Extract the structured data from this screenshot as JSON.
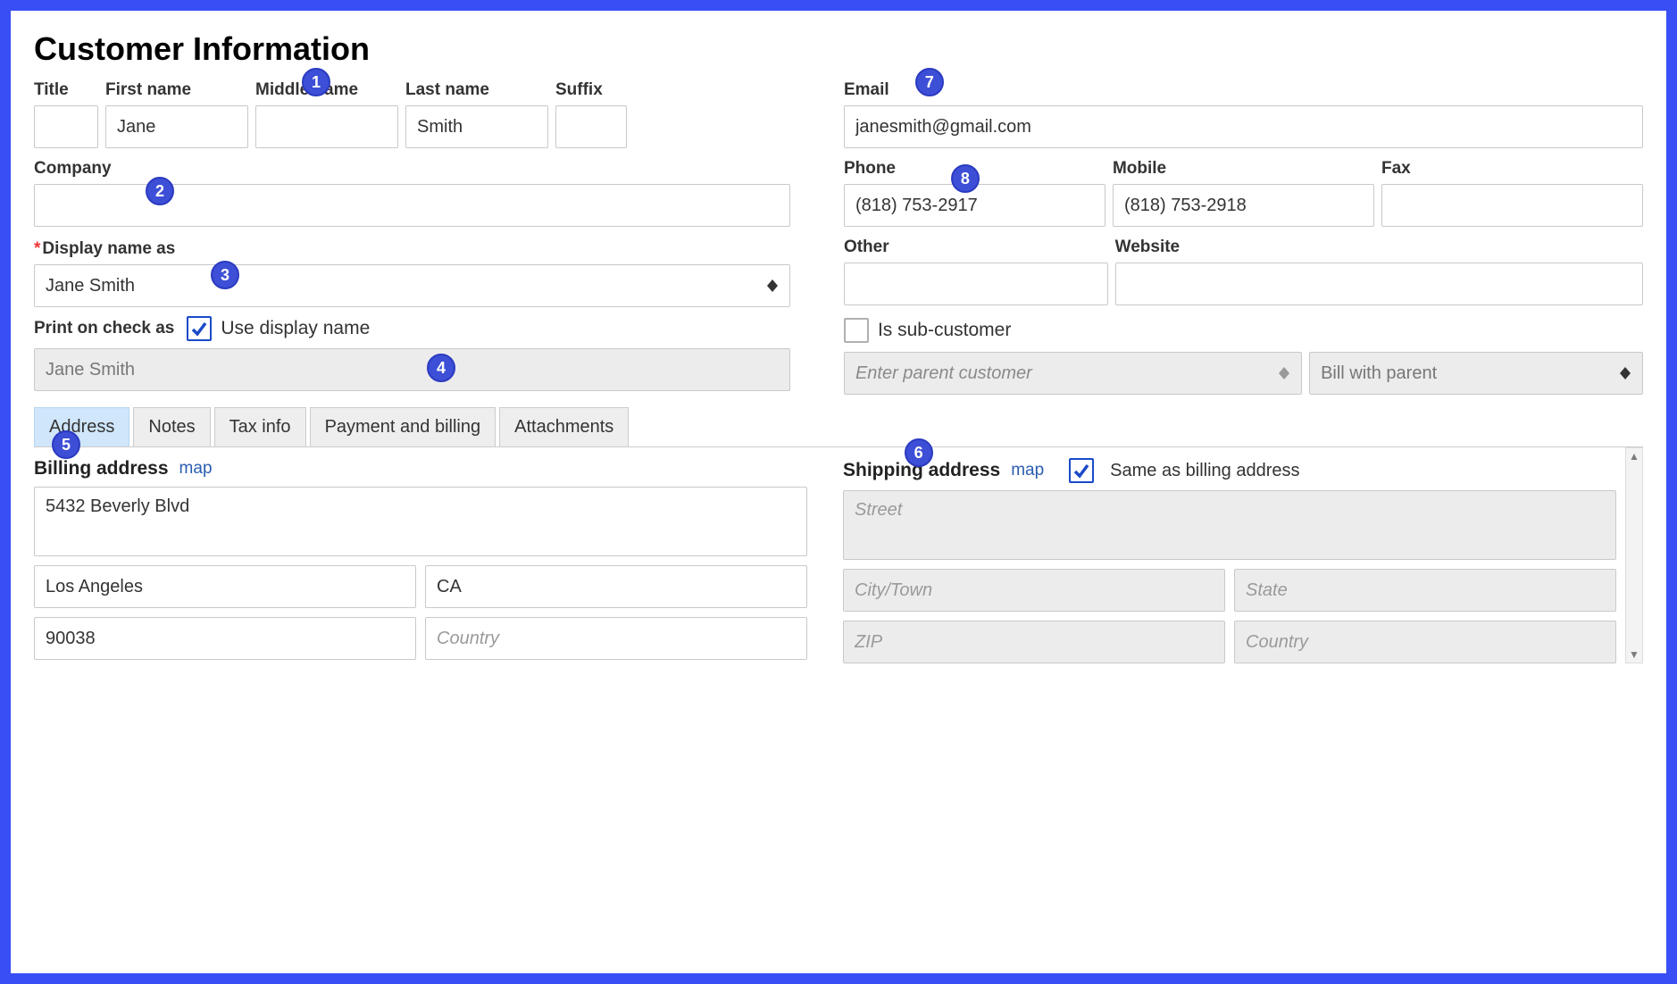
{
  "heading": "Customer Information",
  "labels": {
    "title": "Title",
    "first": "First name",
    "middle": "Middle name",
    "last": "Last name",
    "suffix": "Suffix",
    "company": "Company",
    "display_name": "Display name as",
    "print_on_check": "Print on check as",
    "use_display_name": "Use display name",
    "email": "Email",
    "phone": "Phone",
    "mobile": "Mobile",
    "fax": "Fax",
    "other": "Other",
    "website": "Website",
    "is_sub_customer": "Is sub-customer",
    "billing_address": "Billing address",
    "shipping_address": "Shipping address",
    "same_as_billing": "Same as billing address",
    "map": "map"
  },
  "values": {
    "title": "",
    "first": "Jane",
    "middle": "",
    "last": "Smith",
    "suffix": "",
    "company": "",
    "display_name": "Jane Smith",
    "print_on_check": "Jane Smith",
    "use_display_name_checked": true,
    "email": "janesmith@gmail.com",
    "phone": "(818) 753-2917",
    "mobile": "(818) 753-2918",
    "fax": "",
    "other": "",
    "website": "",
    "is_sub_customer_checked": false,
    "parent_customer_placeholder": "Enter parent customer",
    "bill_with_parent": "Bill with parent",
    "same_as_billing_checked": true
  },
  "tabs": [
    "Address",
    "Notes",
    "Tax info",
    "Payment and billing",
    "Attachments"
  ],
  "active_tab": "Address",
  "billing": {
    "street": "5432 Beverly Blvd",
    "city": "Los Angeles",
    "state": "CA",
    "zip": "90038",
    "country": ""
  },
  "shipping_placeholders": {
    "street": "Street",
    "city": "City/Town",
    "state": "State",
    "zip": "ZIP",
    "country": "Country"
  },
  "billing_placeholders": {
    "country": "Country"
  },
  "badges": [
    "1",
    "2",
    "3",
    "4",
    "5",
    "6",
    "7",
    "8"
  ]
}
